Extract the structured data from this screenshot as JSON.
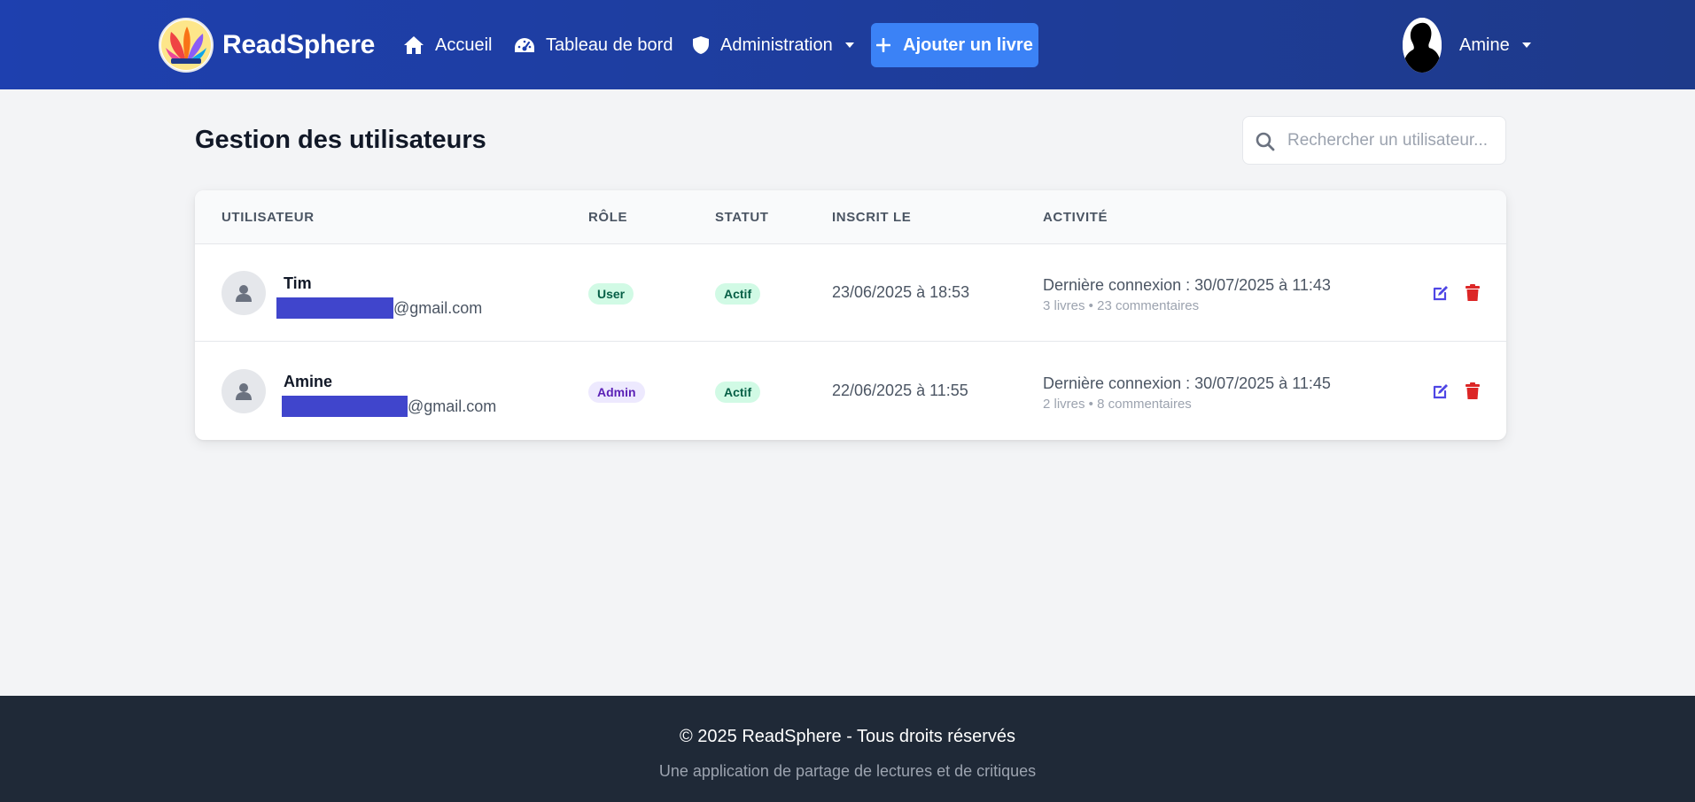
{
  "brand": {
    "name": "ReadSphere"
  },
  "nav": {
    "home": "Accueil",
    "dashboard": "Tableau de bord",
    "admin": "Administration",
    "add_book": "Ajouter un livre",
    "user": "Amine"
  },
  "page": {
    "title": "Gestion des utilisateurs",
    "search_placeholder": "Rechercher un utilisateur..."
  },
  "table": {
    "headers": [
      "UTILISATEUR",
      "RÔLE",
      "STATUT",
      "INSCRIT LE",
      "ACTIVITÉ"
    ],
    "rows": [
      {
        "name": "Tim",
        "email_domain": "@gmail.com",
        "role": "User",
        "status": "Actif",
        "registered": "23/06/2025 à 18:53",
        "last_login": "Dernière connexion : 30/07/2025 à 11:43",
        "stats": "3 livres • 23 commentaires"
      },
      {
        "name": "Amine",
        "email_domain": "@gmail.com",
        "role": "Admin",
        "status": "Actif",
        "registered": "22/06/2025 à 11:55",
        "last_login": "Dernière connexion : 30/07/2025 à 11:45",
        "stats": "2 livres • 8 commentaires"
      }
    ]
  },
  "footer": {
    "copyright": "© 2025 ReadSphere - Tous droits réservés",
    "tagline": "Une application de partage de lectures et de critiques"
  },
  "colors": {
    "navbar": "#1e40af",
    "accent": "#3b82f6",
    "edit": "#4f46e5",
    "delete": "#dc2626",
    "footer": "#1f2937"
  },
  "icons": [
    "home-icon",
    "dashboard-icon",
    "shield-icon",
    "plus-icon",
    "search-icon",
    "user-icon",
    "edit-icon",
    "trash-icon"
  ]
}
